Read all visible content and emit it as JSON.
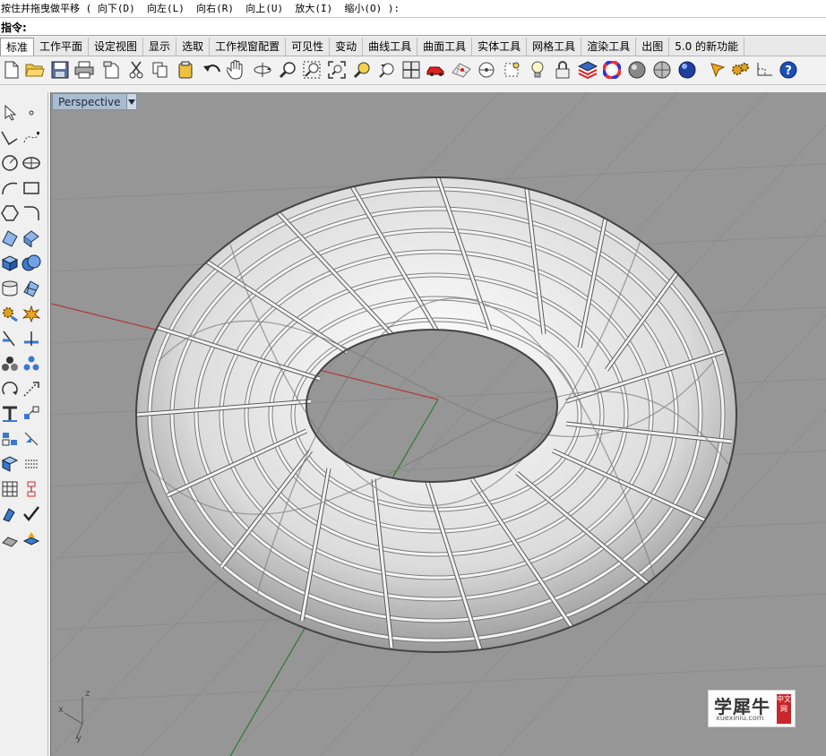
{
  "command_history": {
    "text": "按住并拖曳做平移 ( 向下(D)  向左(L)  向右(R)  向上(U)  放大(I)  缩小(O) ):"
  },
  "command_line": {
    "label": "指令:",
    "value": ""
  },
  "tabs": [
    {
      "label": "标准",
      "active": true
    },
    {
      "label": "工作平面"
    },
    {
      "label": "设定视图"
    },
    {
      "label": "显示"
    },
    {
      "label": "选取"
    },
    {
      "label": "工作视窗配置"
    },
    {
      "label": "可见性"
    },
    {
      "label": "变动"
    },
    {
      "label": "曲线工具"
    },
    {
      "label": "曲面工具"
    },
    {
      "label": "实体工具"
    },
    {
      "label": "网格工具"
    },
    {
      "label": "渲染工具"
    },
    {
      "label": "出图"
    },
    {
      "label": "5.0 的新功能"
    }
  ],
  "toolbar_icons": [
    "new-file-icon",
    "open-folder-icon",
    "save-icon",
    "print-icon",
    "import-icon",
    "cut-icon",
    "copy-icon",
    "paste-icon",
    "undo-icon",
    "pan-hand-icon",
    "rotate-view-icon",
    "zoom-icon",
    "zoom-window-icon",
    "zoom-extents-icon",
    "zoom-selected-icon",
    "undo-view-icon",
    "four-viewports-icon",
    "car-icon",
    "grid-icon",
    "circle-dot-icon",
    "osnap-icon",
    "light-bulb-icon",
    "lock-icon",
    "layer-icon",
    "color-wheel-icon",
    "shaded-sphere-icon",
    "rendered-sphere-icon",
    "blue-sphere-icon",
    "pointer-icon",
    "gear-icon",
    "dimension-icon",
    "help-icon"
  ],
  "viewport": {
    "name": "Perspective",
    "axis_x": "x",
    "axis_y": "y",
    "axis_z": "z"
  },
  "watermark": {
    "title": "学犀牛",
    "url": "xuexiniu.com",
    "stamp": "中文网"
  },
  "colors": {
    "viewport_bg": "#969696",
    "grid_line": "#8a8a8a",
    "x_axis": "#b43838",
    "y_axis": "#2f7a2f",
    "viewport_tab": "#a9bdd0"
  }
}
